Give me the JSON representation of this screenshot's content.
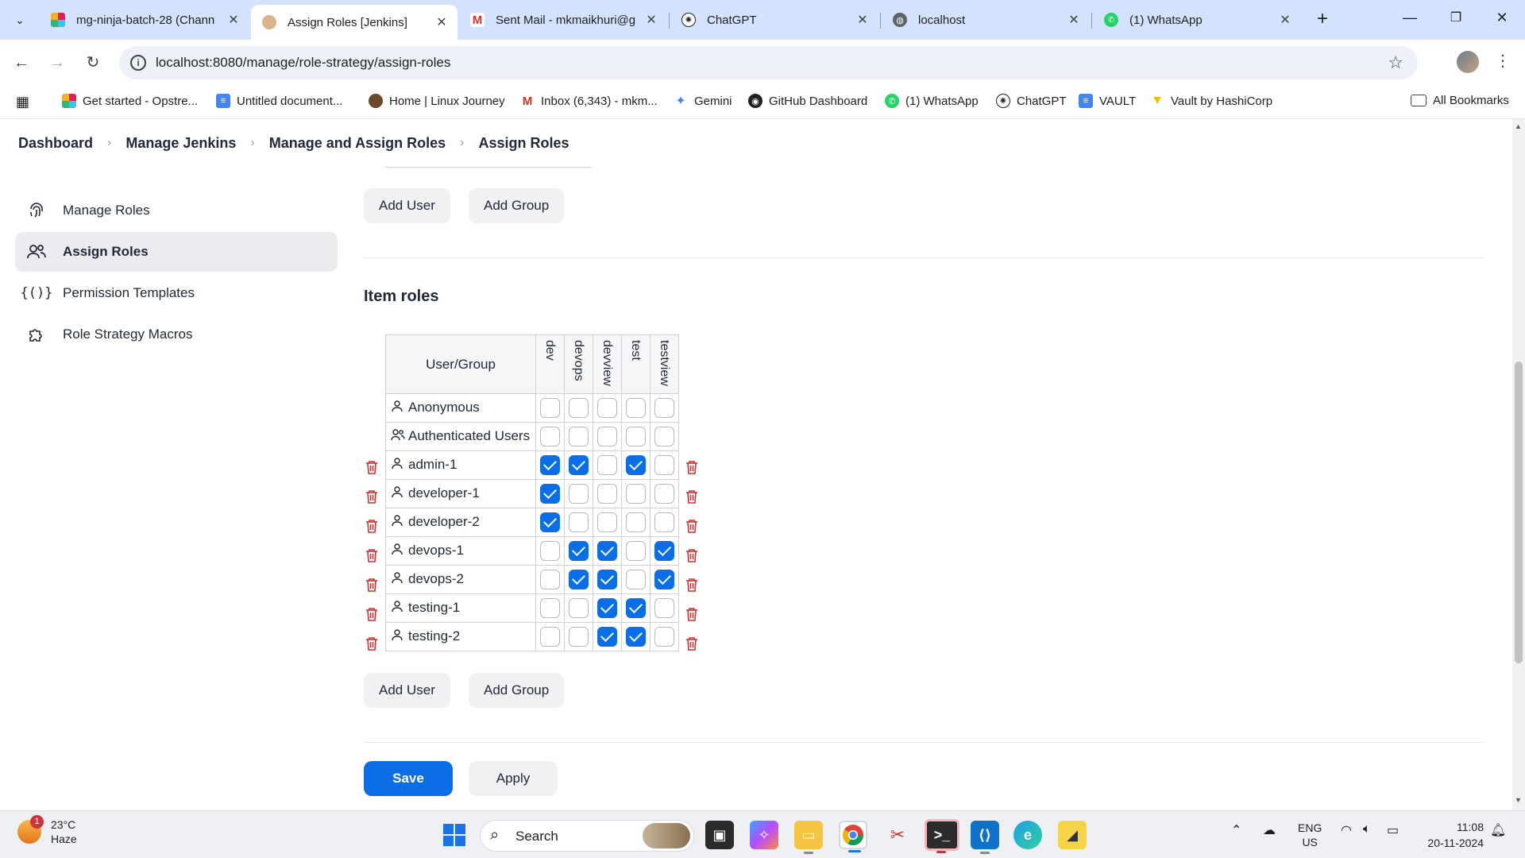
{
  "browser": {
    "tabs": [
      {
        "title": "mg-ninja-batch-28 (Chann",
        "active": false
      },
      {
        "title": "Assign Roles [Jenkins]",
        "active": true
      },
      {
        "title": "Sent Mail - mkmaikhuri@g",
        "active": false
      },
      {
        "title": "ChatGPT",
        "active": false
      },
      {
        "title": "localhost",
        "active": false
      },
      {
        "title": "(1) WhatsApp",
        "active": false
      }
    ],
    "url": "localhost:8080/manage/role-strategy/assign-roles",
    "bookmarks": [
      "Get started - Opstre...",
      "Untitled document...",
      "Home | Linux Journey",
      "Inbox (6,343) - mkm...",
      "Gemini",
      "GitHub Dashboard",
      "(1) WhatsApp",
      "ChatGPT",
      "VAULT",
      "Vault by HashiCorp"
    ],
    "all_bookmarks": "All Bookmarks"
  },
  "breadcrumb": [
    "Dashboard",
    "Manage Jenkins",
    "Manage and Assign Roles",
    "Assign Roles"
  ],
  "sidebar": {
    "items": [
      {
        "label": "Manage Roles",
        "icon": "fingerprint-icon",
        "active": false
      },
      {
        "label": "Assign Roles",
        "icon": "users-icon",
        "active": true
      },
      {
        "label": "Permission Templates",
        "icon": "braces-icon",
        "active": false
      },
      {
        "label": "Role Strategy Macros",
        "icon": "puzzle-icon",
        "active": false
      }
    ]
  },
  "main": {
    "add_user": "Add User",
    "add_group": "Add Group",
    "item_roles_title": "Item roles",
    "table": {
      "header": "User/Group",
      "roles": [
        "dev",
        "devops",
        "devview",
        "test",
        "testview"
      ],
      "rows": [
        {
          "name": "Anonymous",
          "type": "user",
          "deletable": false,
          "checks": [
            false,
            false,
            false,
            false,
            false
          ]
        },
        {
          "name": "Authenticated Users",
          "type": "group",
          "deletable": false,
          "checks": [
            false,
            false,
            false,
            false,
            false
          ]
        },
        {
          "name": "admin-1",
          "type": "user",
          "deletable": true,
          "checks": [
            true,
            true,
            false,
            true,
            false
          ]
        },
        {
          "name": "developer-1",
          "type": "user",
          "deletable": true,
          "checks": [
            true,
            false,
            false,
            false,
            false
          ]
        },
        {
          "name": "developer-2",
          "type": "user",
          "deletable": true,
          "checks": [
            true,
            false,
            false,
            false,
            false
          ]
        },
        {
          "name": "devops-1",
          "type": "user",
          "deletable": true,
          "checks": [
            false,
            true,
            true,
            false,
            true
          ]
        },
        {
          "name": "devops-2",
          "type": "user",
          "deletable": true,
          "checks": [
            false,
            true,
            true,
            false,
            true
          ]
        },
        {
          "name": "testing-1",
          "type": "user",
          "deletable": true,
          "checks": [
            false,
            false,
            true,
            true,
            false
          ]
        },
        {
          "name": "testing-2",
          "type": "user",
          "deletable": true,
          "checks": [
            false,
            false,
            true,
            true,
            false
          ]
        }
      ]
    },
    "save": "Save",
    "apply": "Apply"
  },
  "taskbar": {
    "weather_temp": "23°C",
    "weather_desc": "Haze",
    "weather_badge": "1",
    "search": "Search",
    "lang_top": "ENG",
    "lang_bottom": "US",
    "time": "11:08",
    "date": "20-11-2024"
  },
  "colors": {
    "accent": "#0b6ee6",
    "tabstrip": "#d3e3fd",
    "delete": "#d32f2f"
  }
}
